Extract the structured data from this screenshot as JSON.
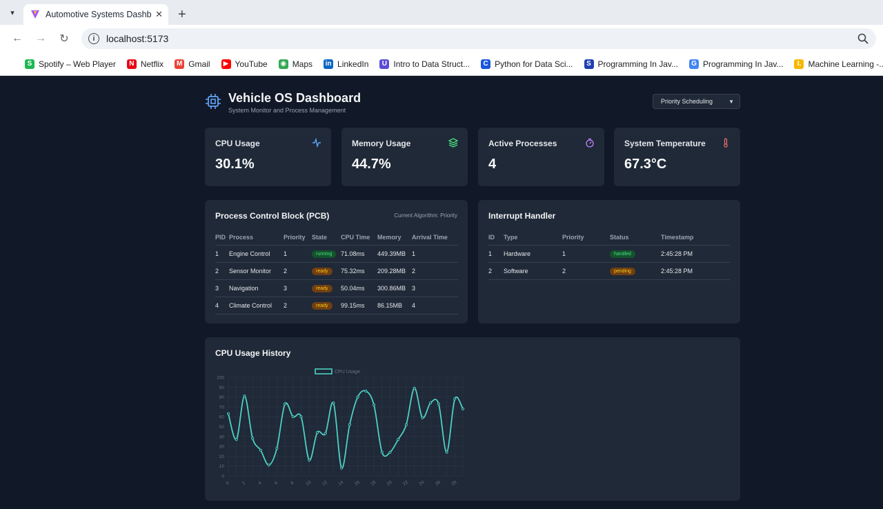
{
  "browser": {
    "tab_title": "Automotive Systems Dashboard",
    "url": "localhost:5173",
    "bookmarks": [
      {
        "label": "Spotify – Web Player",
        "color": "#1db954",
        "glyph": "S"
      },
      {
        "label": "Netflix",
        "color": "#e50914",
        "glyph": "N"
      },
      {
        "label": "Gmail",
        "color": "#ea4335",
        "glyph": "M"
      },
      {
        "label": "YouTube",
        "color": "#ff0000",
        "glyph": "▶"
      },
      {
        "label": "Maps",
        "color": "#34a853",
        "glyph": "◉"
      },
      {
        "label": "LinkedIn",
        "color": "#0a66c2",
        "glyph": "in"
      },
      {
        "label": "Intro to Data Struct...",
        "color": "#5b4bd6",
        "glyph": "U"
      },
      {
        "label": "Python for Data Sci...",
        "color": "#1a56db",
        "glyph": "C"
      },
      {
        "label": "Programming In Jav...",
        "color": "#1e40af",
        "glyph": "S"
      },
      {
        "label": "Programming In Jav...",
        "color": "#4285f4",
        "glyph": "G"
      },
      {
        "label": "Machine Learning -...",
        "color": "#f5b800",
        "glyph": "I."
      }
    ]
  },
  "header": {
    "title": "Vehicle OS Dashboard",
    "subtitle": "System Monitor and Process Management",
    "algorithm_select": "Priority Scheduling"
  },
  "stats": [
    {
      "label": "CPU Usage",
      "value": "30.1%",
      "icon": "activity-icon",
      "color": "#60a5fa"
    },
    {
      "label": "Memory Usage",
      "value": "44.7%",
      "icon": "layers-icon",
      "color": "#4ade80"
    },
    {
      "label": "Active Processes",
      "value": "4",
      "icon": "timer-icon",
      "color": "#c084fc"
    },
    {
      "label": "System Temperature",
      "value": "67.3°C",
      "icon": "thermometer-icon",
      "color": "#f87171"
    }
  ],
  "pcb": {
    "title": "Process Control Block (PCB)",
    "algorithm_note": "Current Algorithm: Priority",
    "columns": [
      "PID",
      "Process",
      "Priority",
      "State",
      "CPU Time",
      "Memory",
      "Arrival Time"
    ],
    "rows": [
      [
        "1",
        "Engine Control",
        "1",
        "running",
        "71.08ms",
        "449.39MB",
        "1"
      ],
      [
        "2",
        "Sensor Monitor",
        "2",
        "ready",
        "75.32ms",
        "209.28MB",
        "2"
      ],
      [
        "3",
        "Navigation",
        "3",
        "ready",
        "50.04ms",
        "300.86MB",
        "3"
      ],
      [
        "4",
        "Climate Control",
        "2",
        "ready",
        "99.15ms",
        "86.15MB",
        "4"
      ]
    ]
  },
  "interrupts": {
    "title": "Interrupt Handler",
    "columns": [
      "ID",
      "Type",
      "Priority",
      "Status",
      "Timestamp"
    ],
    "rows": [
      [
        "1",
        "Hardware",
        "1",
        "handled",
        "2:45:28 PM"
      ],
      [
        "2",
        "Software",
        "2",
        "pending",
        "2:45:28 PM"
      ]
    ]
  },
  "chart_title": "CPU Usage History",
  "chart_data": {
    "type": "line",
    "legend": "top-center",
    "series": [
      {
        "name": "CPU Usage",
        "color": "#4fd1c5"
      }
    ],
    "x": [
      0,
      1,
      2,
      3,
      4,
      5,
      6,
      7,
      8,
      9,
      10,
      11,
      12,
      13,
      14,
      15,
      16,
      17,
      18,
      19,
      20,
      21,
      22,
      23,
      24,
      25,
      26,
      27,
      28,
      29
    ],
    "values": [
      63,
      37,
      81,
      38,
      26,
      11,
      28,
      73,
      60,
      60,
      16,
      44,
      43,
      74,
      8,
      52,
      80,
      86,
      72,
      24,
      24,
      37,
      52,
      89,
      59,
      74,
      73,
      24,
      78,
      68
    ],
    "xticks": [
      "0",
      "2",
      "4",
      "6",
      "8",
      "10",
      "12",
      "14",
      "16",
      "18",
      "20",
      "22",
      "24",
      "26",
      "28"
    ],
    "ylim": [
      0,
      100
    ],
    "yticks": [
      "0",
      "10",
      "20",
      "30",
      "40",
      "50",
      "60",
      "70",
      "80",
      "90",
      "100"
    ],
    "grid": true
  }
}
